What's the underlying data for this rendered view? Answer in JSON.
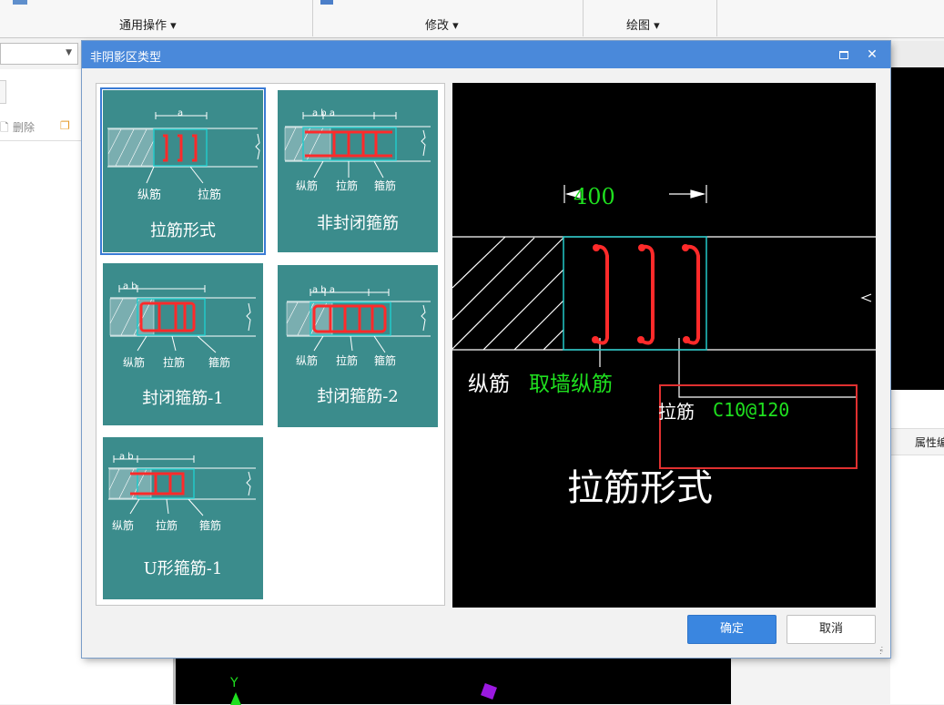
{
  "ribbon": {
    "groups": [
      {
        "label": "通用操作 ▾"
      },
      {
        "label": "修改 ▾"
      },
      {
        "label": "绘图 ▾"
      }
    ]
  },
  "left_panel": {
    "toolbar": {
      "delete_label": "删除"
    }
  },
  "right_panel": {
    "property_label": "属性编"
  },
  "dialog": {
    "title": "非阴影区类型",
    "maximize_label": "maximize-icon",
    "close_label": "✕",
    "tiles": [
      {
        "label": "拉筋形式",
        "sub1": "纵筋",
        "sub2": "拉筋",
        "dim": "a"
      },
      {
        "label": "非封闭箍筋",
        "sub1": "纵筋",
        "sub2": "拉筋",
        "sub3": "箍筋",
        "dim": "a   b   a"
      },
      {
        "label": "封闭箍筋-1",
        "sub1": "纵筋",
        "sub2": "拉筋",
        "sub3": "箍筋",
        "dim": "a   b"
      },
      {
        "label": "封闭箍筋-2",
        "sub1": "纵筋",
        "sub2": "拉筋",
        "sub3": "箍筋",
        "dim": "a   b   a"
      },
      {
        "label": "U形箍筋-1",
        "sub1": "纵筋",
        "sub2": "拉筋",
        "sub3": "箍筋",
        "dim": "a   b"
      }
    ],
    "selected_tile": 0,
    "preview": {
      "dimension": "400",
      "label1": "纵筋",
      "value1": "取墙纵筋",
      "label2": "拉筋",
      "value2": "C10@120",
      "title": "拉筋形式"
    },
    "ok_label": "确定",
    "cancel_label": "取消"
  },
  "canvas_axis": "Y",
  "colors": {
    "titlebar": "#4a89da",
    "tile": "#3b8c8c",
    "rebar": "#ff2a2a",
    "highlight": "#e03030",
    "dimension": "#1fe01f",
    "outline": "#23c9c9"
  }
}
